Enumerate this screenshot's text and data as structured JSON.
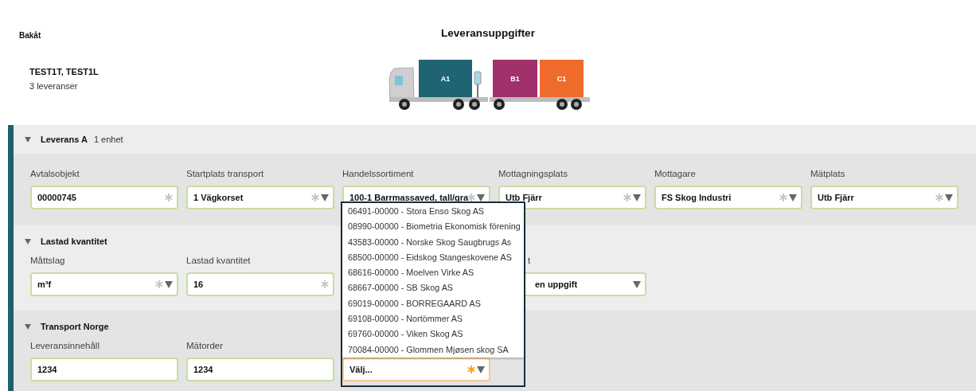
{
  "back_link": "Bakåt",
  "title": "Leveransuppgifter",
  "client": {
    "name": "TEST1T, TEST1L",
    "deliveries": "3 leveranser"
  },
  "truck": {
    "cargo": [
      {
        "label": "A1",
        "color": "#1f6473"
      },
      {
        "label": "B1",
        "color": "#a2306b"
      },
      {
        "label": "C1",
        "color": "#ef6b2b"
      }
    ]
  },
  "sections": [
    {
      "title": "Leverans A",
      "subtitle": "1 enhet",
      "expanded": true,
      "fields": [
        {
          "label": "Avtalsobjekt",
          "value": "00000745",
          "required": true,
          "missing": false,
          "dropdown": false,
          "open": false,
          "covered": false
        },
        {
          "label": "Startplats transport",
          "value": "1 Vägkorset",
          "required": true,
          "missing": false,
          "dropdown": true,
          "open": false,
          "covered": false
        },
        {
          "label": "Handelssortiment",
          "value": "100-1 Barrmassaved, tall/gra",
          "required": true,
          "missing": false,
          "dropdown": true,
          "open": false,
          "covered": false
        },
        {
          "label": "Mottagningsplats",
          "value": "Utb Fjärr",
          "required": true,
          "missing": false,
          "dropdown": true,
          "open": false,
          "covered": false
        },
        {
          "label": "Mottagare",
          "value": "FS Skog Industri",
          "required": true,
          "missing": false,
          "dropdown": true,
          "open": false,
          "covered": false
        },
        {
          "label": "Mätplats",
          "value": "Utb Fjärr",
          "required": true,
          "missing": false,
          "dropdown": true,
          "open": false,
          "covered": false
        }
      ]
    },
    {
      "title": "Lastad kvantitet",
      "expanded": true,
      "fields": [
        {
          "label": "Måttslag",
          "value": "m³f",
          "required": true,
          "missing": false,
          "dropdown": true,
          "open": false,
          "covered": false
        },
        {
          "label": "Lastad kvantitet",
          "value": "16",
          "required": true,
          "missing": false,
          "dropdown": false,
          "open": false,
          "covered": false
        },
        {
          "label": "t",
          "value": "en uppgift",
          "required": false,
          "dropdown": true,
          "open": false,
          "covered": true
        }
      ]
    },
    {
      "title": "Transport Norge",
      "expanded": true,
      "fields": [
        {
          "label": "Leveransinnehåll",
          "value": "1234",
          "required": false,
          "dropdown": false,
          "open": false,
          "covered": false
        },
        {
          "label": "Mätorder",
          "value": "1234",
          "required": false,
          "dropdown": false,
          "open": false,
          "covered": false
        },
        {
          "value": "Välj...",
          "required": true,
          "missing": true,
          "dropdown": true,
          "open": true,
          "covered": false,
          "options": [
            {
              "label": "06491-00000 - Stora Enso Skog AS",
              "selected": false
            },
            {
              "label": "08990-00000 - Biometria Ekonomisk förening",
              "selected": false
            },
            {
              "label": "43583-00000 - Norske Skog Saugbrugs As",
              "selected": false
            },
            {
              "label": "68500-00000 - Eidskog Stangeskovene AS",
              "selected": false
            },
            {
              "label": "68616-00000 - Moelven Virke AS",
              "selected": false
            },
            {
              "label": "68667-00000 - SB Skog AS",
              "selected": false
            },
            {
              "label": "69019-00000 - BORREGAARD AS",
              "selected": false
            },
            {
              "label": "69108-00000 - Nortömmer AS",
              "selected": false
            },
            {
              "label": "69760-00000 - Viken Skog AS",
              "selected": false
            },
            {
              "label": "70084-00000 - Glommen Mjøsen skog SA",
              "selected": false
            }
          ]
        }
      ]
    }
  ]
}
